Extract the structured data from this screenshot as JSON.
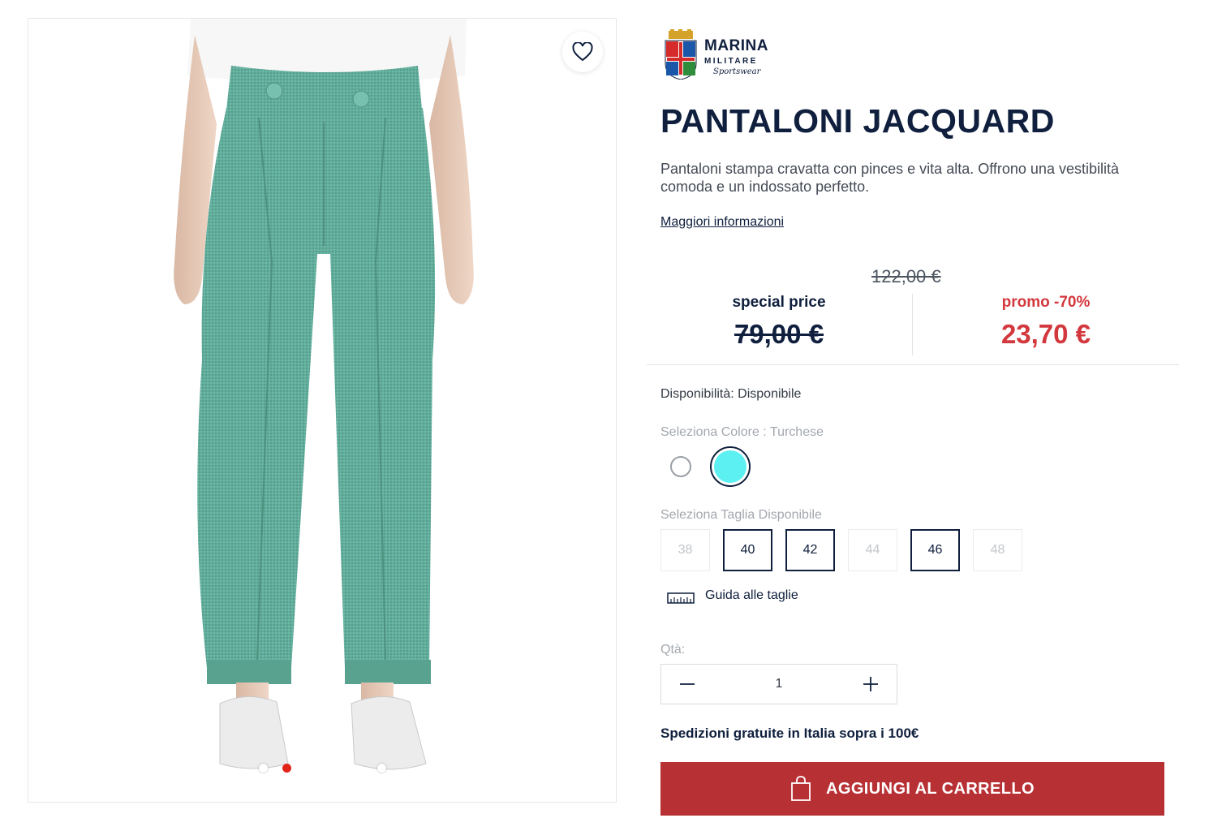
{
  "gallery": {
    "image_alt": "",
    "active_slide": 2,
    "slide_count": 3,
    "wishlist_icon": "heart-outline-icon"
  },
  "brand": {
    "name": "MARINA",
    "sub": "MILITARE",
    "script": "Sportswear"
  },
  "product": {
    "title": "PANTALONI JACQUARD",
    "description": "Pantaloni stampa cravatta con pinces e vita alta. Offrono una vestibilità comoda e un indossato perfetto.",
    "more_info": "Maggiori informazioni"
  },
  "pricing": {
    "original": "122,00 €",
    "special_label": "special price",
    "special_value": "79,00 €",
    "promo_label": "promo -70%",
    "promo_value": "23,70 €",
    "promo_color": "#d2383d"
  },
  "availability": {
    "label": "Disponibilità:",
    "value": "Disponibile"
  },
  "color": {
    "label": "Seleziona Colore : Turchese",
    "options": [
      {
        "name": "white",
        "hex": "#ffffff",
        "selected": false
      },
      {
        "name": "turchese",
        "hex": "#5cf0f2",
        "selected": true
      }
    ]
  },
  "size": {
    "label": "Seleziona Taglia Disponibile",
    "options": [
      {
        "value": "38",
        "available": false
      },
      {
        "value": "40",
        "available": true
      },
      {
        "value": "42",
        "available": true
      },
      {
        "value": "44",
        "available": false
      },
      {
        "value": "46",
        "available": true
      },
      {
        "value": "48",
        "available": false
      }
    ],
    "guide_label": "Guida alle taglie",
    "guide_icon": "ruler-icon"
  },
  "quantity": {
    "label": "Qtà:",
    "value": "1",
    "minus_icon": "minus-icon",
    "plus_icon": "plus-icon"
  },
  "shipping": {
    "text": "Spedizioni gratuite in Italia sopra i 100€"
  },
  "cart": {
    "label": "AGGIUNGI AL CARRELLO",
    "icon": "shopping-bag-icon",
    "color": "#b73034"
  }
}
